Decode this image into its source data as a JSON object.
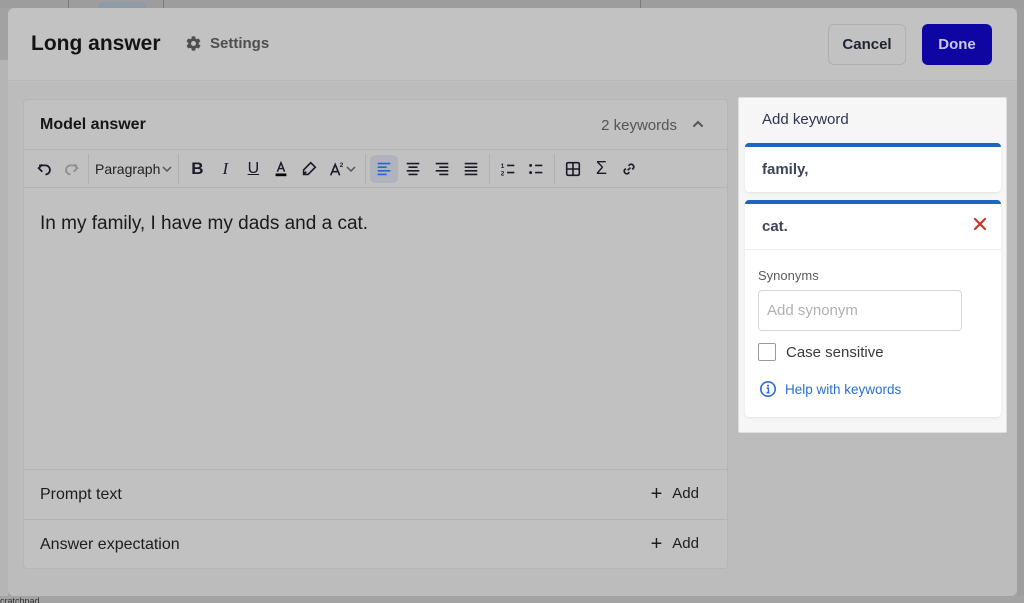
{
  "modal": {
    "title": "Long answer",
    "settings_label": "Settings",
    "cancel_label": "Cancel",
    "done_label": "Done"
  },
  "model_answer": {
    "title": "Model answer",
    "keyword_count": "2 keywords",
    "toolbar": {
      "paragraph_label": "Paragraph",
      "buttons": [
        "undo",
        "redo",
        "bold",
        "italic",
        "underline",
        "text-color",
        "highlight",
        "superscript",
        "align-left",
        "align-center",
        "align-right",
        "justify",
        "numbered-list",
        "bullet-list",
        "table",
        "math",
        "link"
      ],
      "active": "align-left"
    },
    "content": "In my family, I have my dads and a cat."
  },
  "rows": [
    {
      "label": "Prompt text",
      "action": "Add"
    },
    {
      "label": "Answer expectation",
      "action": "Add"
    }
  ],
  "keywords_panel": {
    "add_label": "Add keyword",
    "keywords": [
      {
        "word": "family,"
      },
      {
        "word": "cat."
      }
    ],
    "synonyms_label": "Synonyms",
    "synonym_placeholder": "Add synonym",
    "synonym_value": "",
    "case_sensitive_label": "Case sensitive",
    "case_sensitive_checked": false,
    "help_label": "Help with keywords"
  },
  "background": {
    "bottom_text": "cratchpad"
  },
  "colors": {
    "primary": "#0f05a3",
    "keyword_accent": "#1f64c0",
    "remove": "#c0392b",
    "link": "#2a6fd6"
  }
}
